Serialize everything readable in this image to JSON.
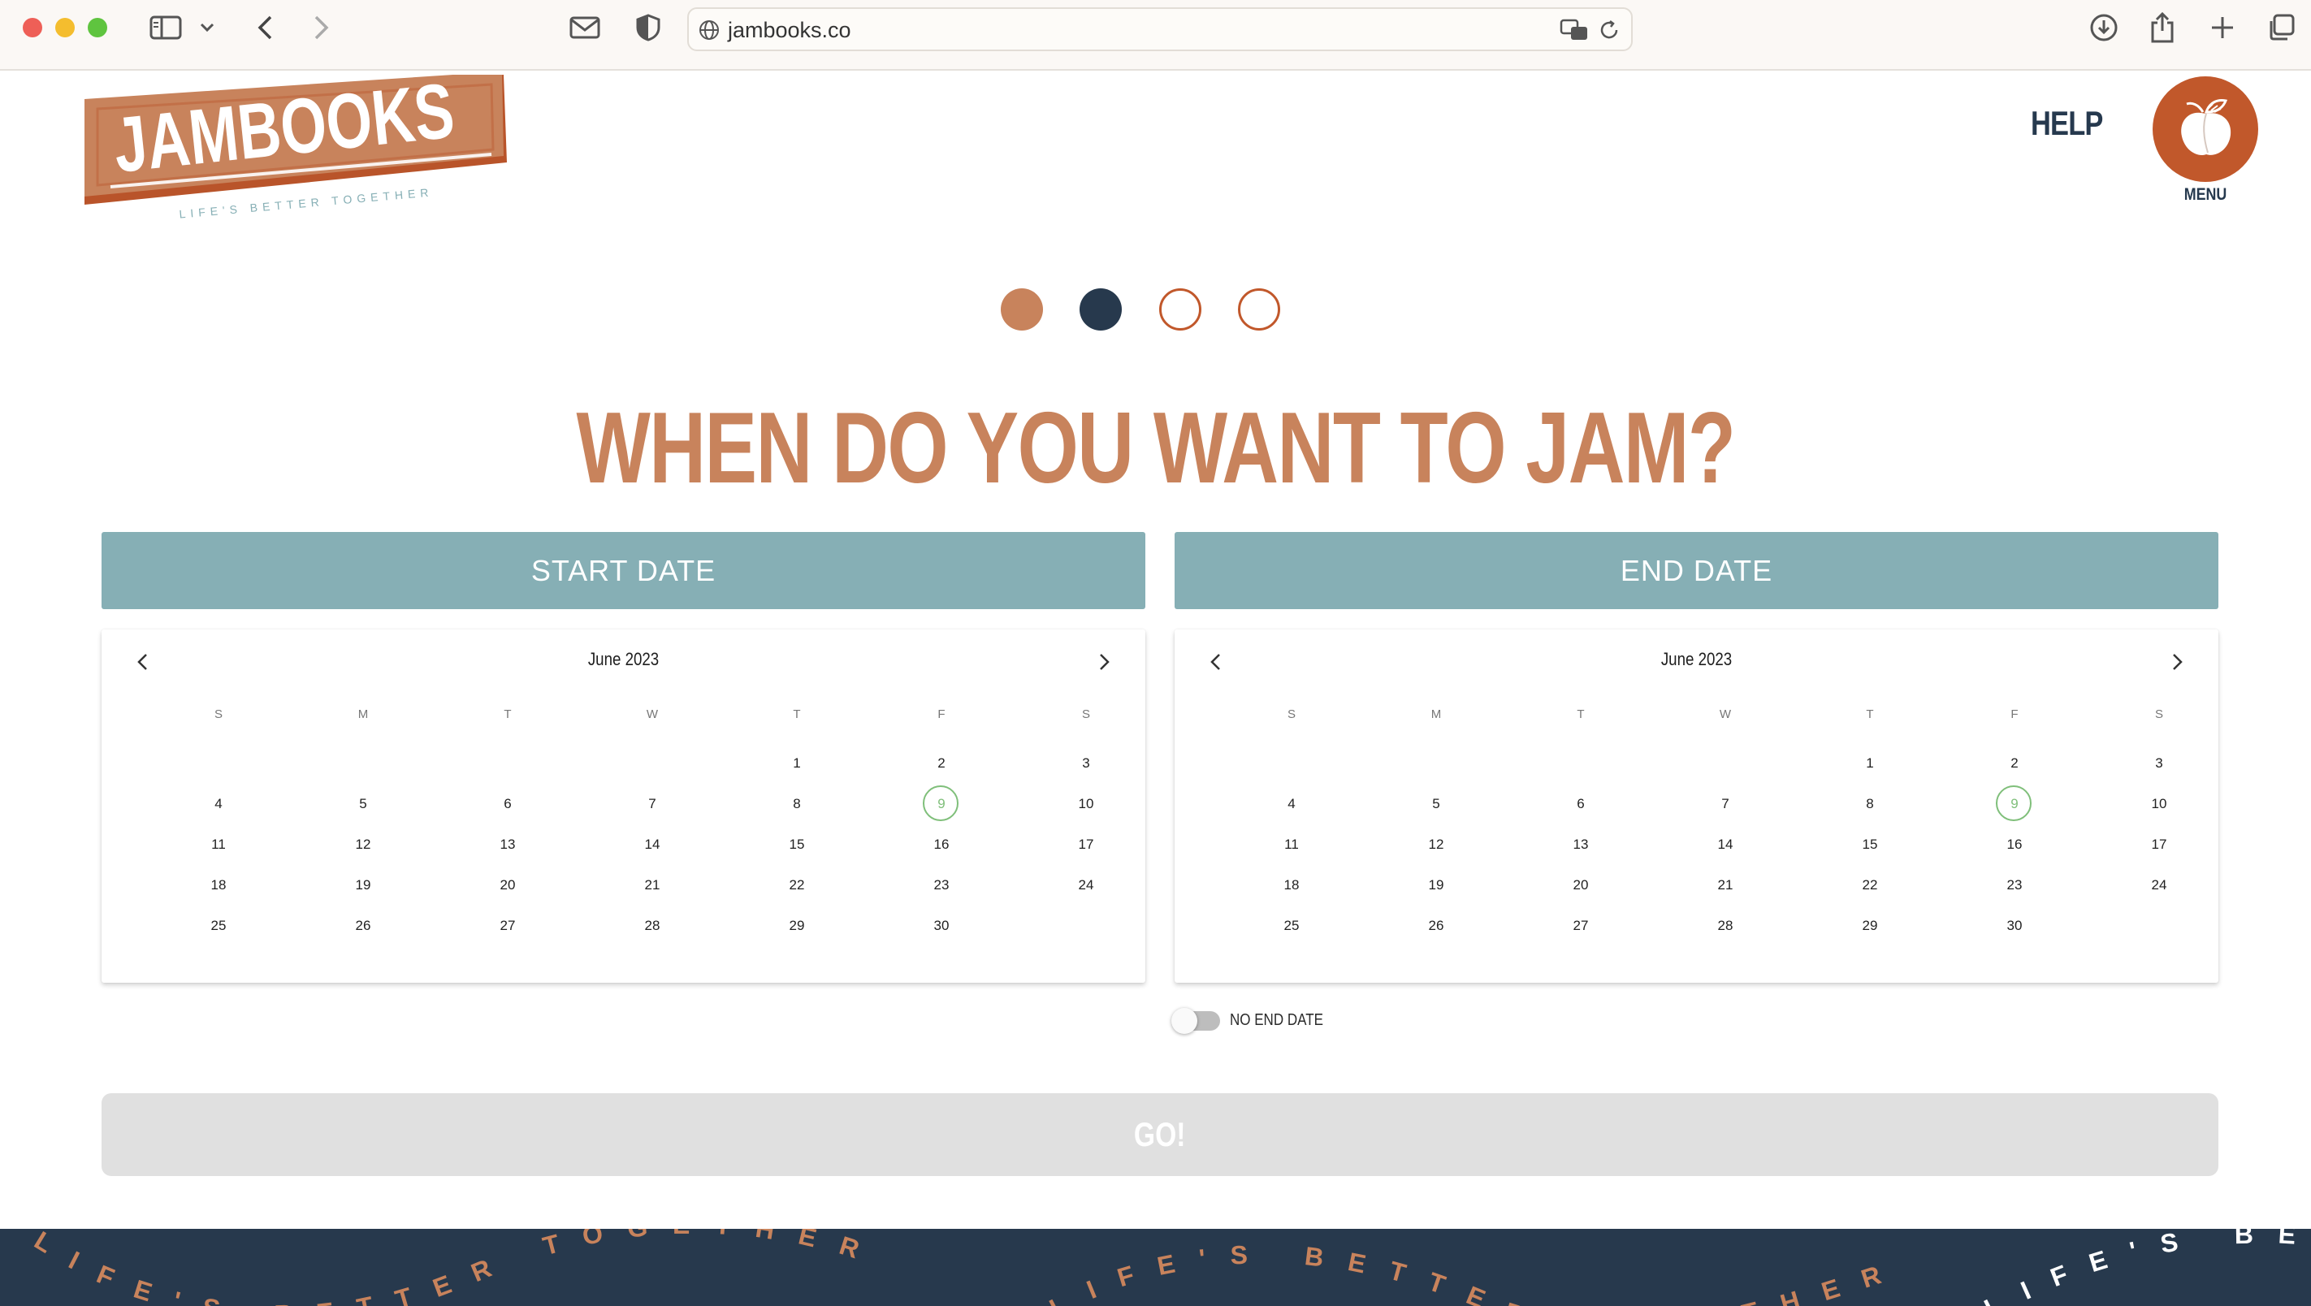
{
  "browser": {
    "url": "jambooks.co"
  },
  "header": {
    "logo_text": "JAMBOOKS",
    "logo_tagline": "LIFE'S BETTER TOGETHER",
    "help_label": "HELP",
    "menu_label": "MENU"
  },
  "progress": {
    "total_steps": 4,
    "current_step": 2
  },
  "main": {
    "heading": "WHEN DO YOU WANT TO JAM?",
    "start_date_label": "START DATE",
    "end_date_label": "END DATE",
    "no_end_date_label": "NO END DATE",
    "go_label": "GO!"
  },
  "calendar": {
    "month": "June 2023",
    "weekdays": [
      "S",
      "M",
      "T",
      "W",
      "T",
      "F",
      "S"
    ],
    "today": "9",
    "weeks": [
      [
        "",
        "",
        "",
        "",
        "1",
        "2",
        "3"
      ],
      [
        "4",
        "5",
        "6",
        "7",
        "8",
        "9",
        "10"
      ],
      [
        "11",
        "12",
        "13",
        "14",
        "15",
        "16",
        "17"
      ],
      [
        "18",
        "19",
        "20",
        "21",
        "22",
        "23",
        "24"
      ],
      [
        "25",
        "26",
        "27",
        "28",
        "29",
        "30",
        ""
      ]
    ]
  },
  "footer": {
    "ticker_text": "LIFE'S BETTER TOGETHER"
  },
  "colors": {
    "brand_orange": "#c1582b",
    "heading_peach": "#c8835c",
    "navy": "#27394d",
    "teal": "#86afb5",
    "today_green": "#7fbf7a"
  }
}
